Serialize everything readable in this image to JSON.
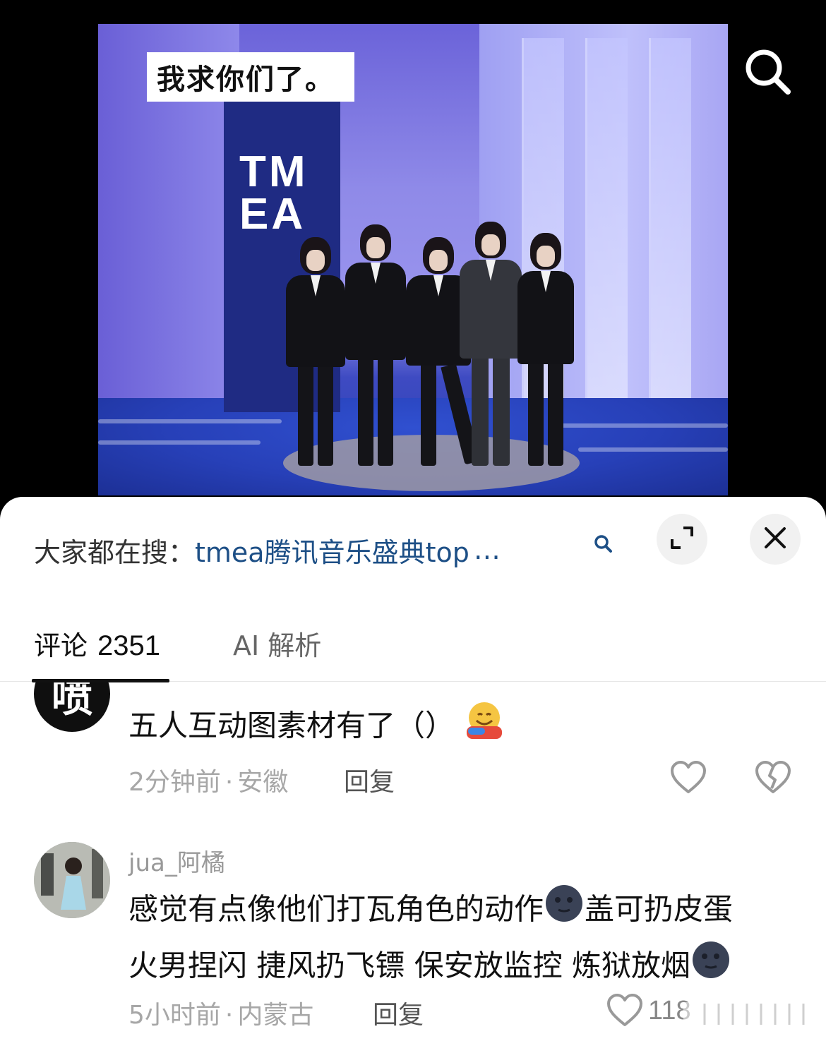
{
  "video": {
    "caption": "我求你们了。",
    "logo_text": "TMEA",
    "search_icon": "search-icon"
  },
  "sheet": {
    "suggest_prefix": "大家都在搜：",
    "suggest_query": "tmea腾讯音乐盛典top",
    "suggest_ellipsis": "…",
    "suggest_icon": "search-icon",
    "expand_icon": "expand-icon",
    "close_icon": "close-icon"
  },
  "tabs": {
    "comments_label": "评论",
    "comments_count": "2351",
    "ai_label": "AI 解析"
  },
  "comments": [
    {
      "avatar_text": "喷",
      "text": "五人互动图素材有了（）",
      "emoji": "hugging-face-emoji",
      "time": "2分钟前",
      "location": "安徽",
      "separator": "·",
      "reply_label": "回复",
      "like_icon": "heart-icon",
      "dislike_icon": "broken-heart-icon"
    },
    {
      "username": "jua_阿橘",
      "text_line1": "感觉有点像他们打瓦角色的动作",
      "text_line1b": "盖可扔皮蛋",
      "text_line2": "火男捏闪 捷风扔飞镖 保安放监控 炼狱放烟",
      "emoji": "new-moon-face-emoji",
      "time": "5小时前",
      "location": "内蒙古",
      "separator": "·",
      "reply_label": "回复",
      "like_icon": "heart-icon",
      "like_count": "118"
    }
  ],
  "colors": {
    "link": "#1d4f86",
    "meta": "#a7a7a7",
    "video_stage": "#6b63d9"
  }
}
